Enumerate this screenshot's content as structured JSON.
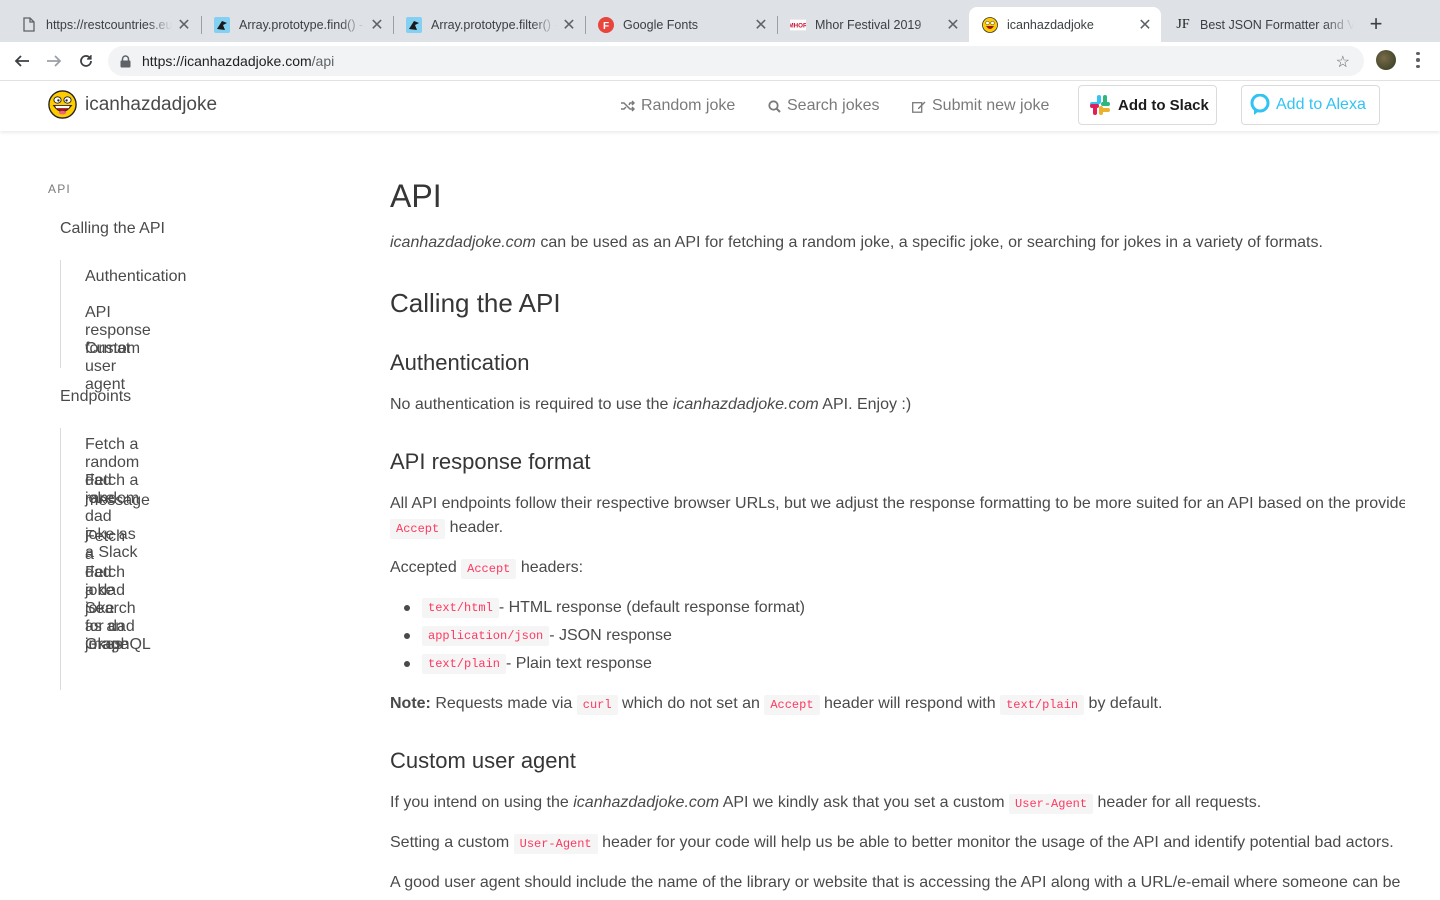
{
  "browser": {
    "tabs": [
      {
        "title": "https://restcountries.eu",
        "favicon": "document-icon"
      },
      {
        "title": "Array.prototype.find() - J",
        "favicon": "mdn-icon"
      },
      {
        "title": "Array.prototype.filter() -",
        "favicon": "mdn-icon"
      },
      {
        "title": "Google Fonts",
        "favicon": "google-fonts-icon"
      },
      {
        "title": "Mhor Festival 2019",
        "favicon": "mhor-icon"
      },
      {
        "title": "icanhazdadjoke",
        "favicon": "laughing-face-icon",
        "active": true
      },
      {
        "title": "Best JSON Formatter and V",
        "favicon": "jf-icon"
      }
    ],
    "url_domain": "https://icanhazdadjoke.com",
    "url_path": "/api"
  },
  "header": {
    "brand": "icanhazdadjoke",
    "nav": {
      "random": "Random joke",
      "search": "Search jokes",
      "submit": "Submit new joke"
    },
    "slack_prefix": "Add to ",
    "slack_bold": "Slack",
    "alexa": "Add to Alexa"
  },
  "sidebar": {
    "label": "API",
    "calling": "Calling the API",
    "calling_items": [
      "Authentication",
      "API response format",
      "Custom user agent"
    ],
    "endpoints": "Endpoints",
    "endpoint_items": [
      "Fetch a random dad joke",
      "Fetch a random dad joke as a Slack",
      "message",
      "Fetch a dad joke",
      "Fetch a dad joke as an image",
      "Search for dad jokes",
      "GraphQL"
    ]
  },
  "content": {
    "title": "API",
    "intro_em": "icanhazdadjoke.com",
    "intro_rest": " can be used as an API for fetching a random joke, a specific joke, or searching for jokes in a variety of formats.",
    "calling_title": "Calling the API",
    "auth_title": "Authentication",
    "auth_pre": "No authentication is required to use the ",
    "auth_em": "icanhazdadjoke.com",
    "auth_post": " API. Enjoy :)",
    "format_title": "API response format",
    "format_p1": "All API endpoints follow their respective browser URLs, but we adjust the response formatting to be more suited for an API based on the provided HTTP",
    "accept_code": "Accept",
    "format_p1b": " header.",
    "accepted_pre": "Accepted ",
    "accepted_post": " headers:",
    "bullets": [
      {
        "code": "text/html",
        "text": " - HTML response (default response format)"
      },
      {
        "code": "application/json",
        "text": " - JSON response"
      },
      {
        "code": "text/plain",
        "text": " - Plain text response"
      }
    ],
    "note_bold": "Note:",
    "note_1": " Requests made via ",
    "note_curl": "curl",
    "note_2": " which do not set an ",
    "note_3": " header will respond with ",
    "note_plain": "text/plain",
    "note_4": " by default.",
    "ua_title": "Custom user agent",
    "ua_p1_pre": "If you intend on using the ",
    "ua_p1_em": "icanhazdadjoke.com",
    "ua_p1_mid": " API we kindly ask that you set a custom ",
    "ua_code": "User-Agent",
    "ua_p1_post": " header for all requests.",
    "ua_p2_pre": "Setting a custom ",
    "ua_p2_post": " header for your code will help us be able to better monitor the usage of the API and identify potential bad actors.",
    "ua_p3": "A good user agent should include the name of the library or website that is accessing the API along with a URL/e-email where someone can be contacted regarding the library/website."
  },
  "colors": {
    "code_text": "#ff3860",
    "code_bg": "#f5f5f5",
    "alexa": "#31c4f3",
    "tabbar": "#dee1e6"
  }
}
